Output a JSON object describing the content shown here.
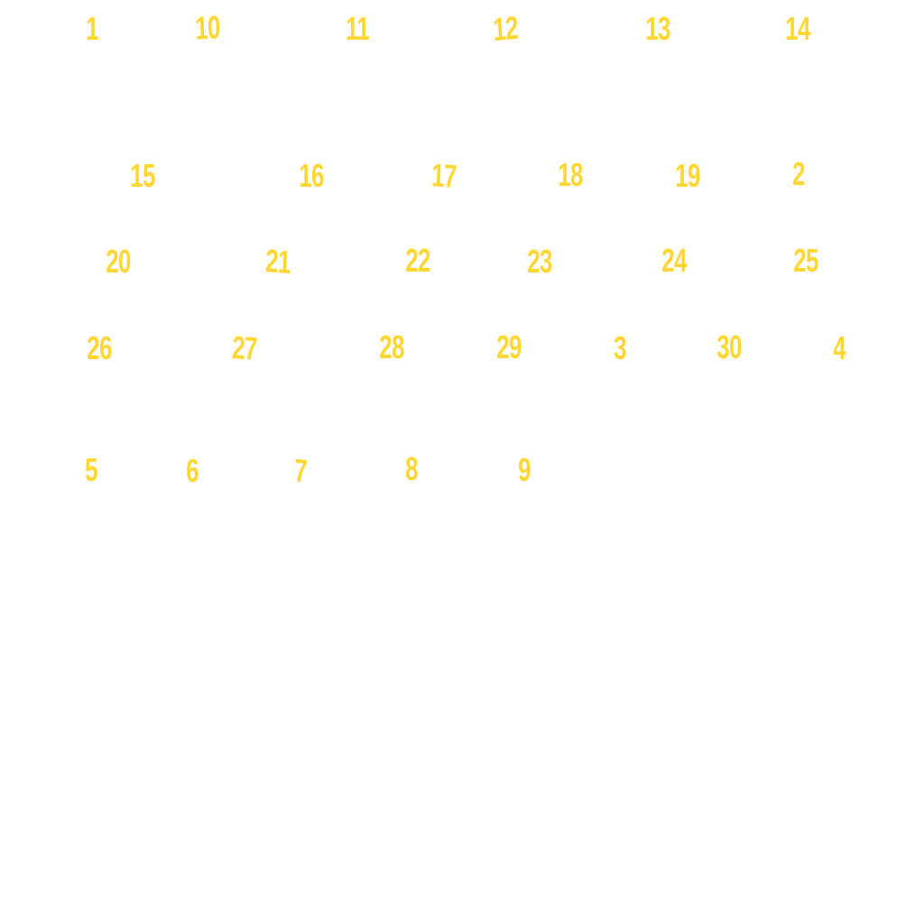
{
  "text_color": "#FFD633",
  "background_color": "#FFFFFF",
  "numbers": [
    "1",
    "10",
    "11",
    "12",
    "13",
    "14",
    "15",
    "16",
    "17",
    "18",
    "19",
    "2",
    "20",
    "21",
    "22",
    "23",
    "24",
    "25",
    "26",
    "27",
    "28",
    "29",
    "3",
    "30",
    "4",
    "5",
    "6",
    "7",
    "8",
    "9"
  ]
}
